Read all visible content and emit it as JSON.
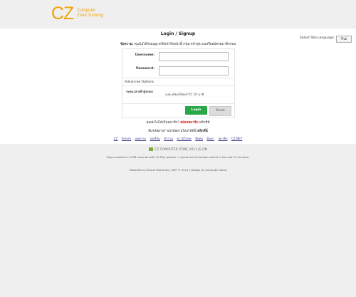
{
  "logo": {
    "mark": "CZ",
    "line1": "Computer",
    "line2": "Zone Tutoring"
  },
  "language": {
    "label": "Select Site Language:",
    "selected": "Thai"
  },
  "title": "Login / Signup",
  "notice": {
    "prefix": "ข้อความ:",
    "text": "คุณไม่ได้รับอนุญาตให้เข้าถึงหน้านี้ กรุณาเข้าสู่ระบบหรือสมัครสมาชิกก่อน"
  },
  "form": {
    "username_label": "Username:",
    "password_label": "Password:",
    "advanced_label": "Advanced Options",
    "session_label": "ระยะเวลาเข้าสู่ระบบ:",
    "session_value": "ลงทะเบียนให้จดจำไว้ 10 นาที",
    "login_button": "Login",
    "reset_button": "Reset"
  },
  "signup_line": {
    "prefix": "คุณยังไม่ได้เป็นสมาชิก?",
    "link": "สมัครสมาชิก",
    "suffix": "คลิกที่นี่"
  },
  "forgot_line": {
    "text": "ลืมรหัสผ่าน? ขอรหัสผ่านใหม่ได้ที่นี่",
    "link": "คลิกที่นี่"
  },
  "links": [
    "CZ",
    "Forum",
    "บทความ",
    "บทเรียน",
    "คำถาม",
    "ดาวน์โหลด",
    "ติดต่อ",
    "ค้นหา",
    "สมาชิก",
    "CZ.NET"
  ],
  "powered": "CZ COMPUTER ZONE 2011 JS ON",
  "stats": "Page created in 0.038 seconds with 19 SQL queries. 1 guest and 0 member online in the last 15 minutes.",
  "footer": "Powered by Simple Machines | SMF © 2011 | Design by Computer Zone"
}
